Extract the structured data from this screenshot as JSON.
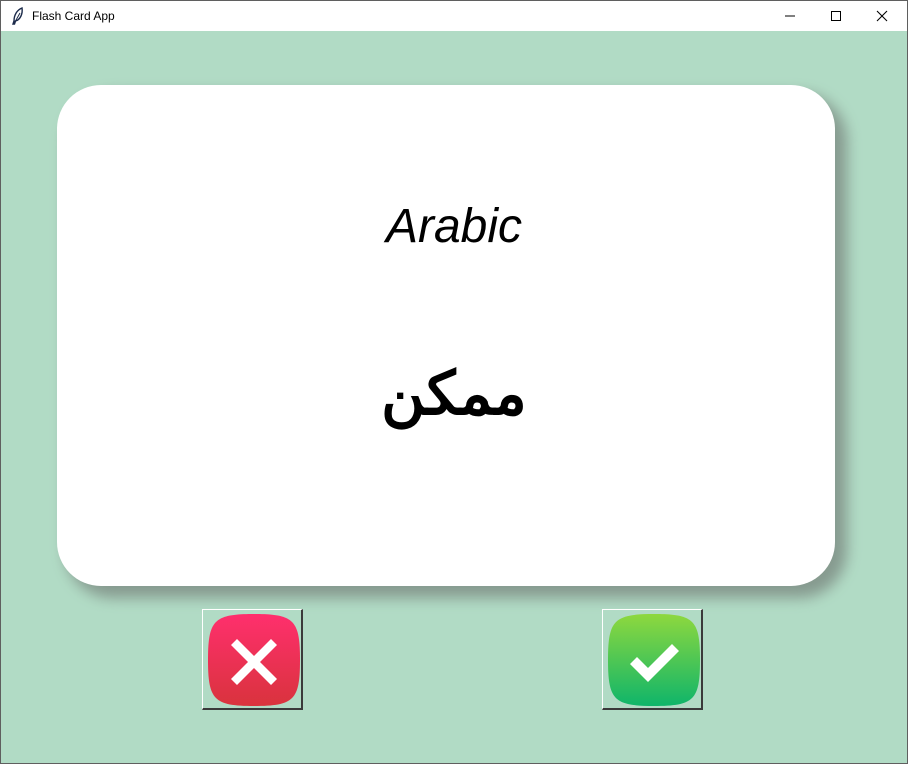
{
  "window": {
    "title": "Flash Card App",
    "controls": {
      "minimize_icon": "minimize-icon",
      "maximize_icon": "maximize-icon",
      "close_icon": "close-icon"
    }
  },
  "colors": {
    "background": "#b1dbc5",
    "card": "#ffffff",
    "wrong_button": "#e8304f",
    "right_button": "#2fc45e"
  },
  "card": {
    "language": "Arabic",
    "word": "ممكن"
  },
  "buttons": {
    "wrong_icon": "x-mark-icon",
    "right_icon": "checkmark-icon"
  }
}
